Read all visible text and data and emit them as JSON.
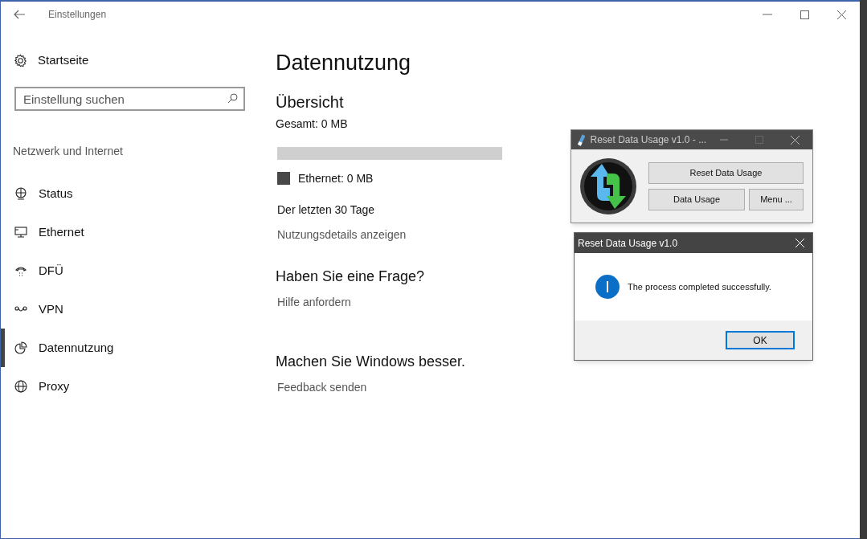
{
  "window": {
    "title": "Einstellungen"
  },
  "sidebar": {
    "home": "Startseite",
    "search": {
      "placeholder": "Einstellung suchen"
    },
    "section": "Netzwerk und Internet",
    "items": [
      {
        "label": "Status",
        "selected": false
      },
      {
        "label": "Ethernet",
        "selected": false
      },
      {
        "label": "DFÜ",
        "selected": false
      },
      {
        "label": "VPN",
        "selected": false
      },
      {
        "label": "Datennutzung",
        "selected": true
      },
      {
        "label": "Proxy",
        "selected": false
      }
    ]
  },
  "main": {
    "title": "Datennutzung",
    "overview": {
      "heading": "Übersicht",
      "total": "Gesamt: 0 MB",
      "legend": "Ethernet: 0 MB",
      "period": "Der letzten 30 Tage",
      "link": "Nutzungsdetails anzeigen"
    },
    "sections": [
      {
        "heading": "Haben Sie eine Frage?",
        "link": "Hilfe anfordern"
      },
      {
        "heading": "Machen Sie Windows besser.",
        "link": "Feedback senden"
      }
    ]
  },
  "app_window": {
    "title": "Reset Data Usage v1.0 - ...",
    "buttons": [
      "Reset Data Usage",
      "Data Usage",
      "Menu ..."
    ]
  },
  "dialog": {
    "title": "Reset Data Usage v1.0",
    "message": "The process completed successfully.",
    "button": "OK"
  }
}
